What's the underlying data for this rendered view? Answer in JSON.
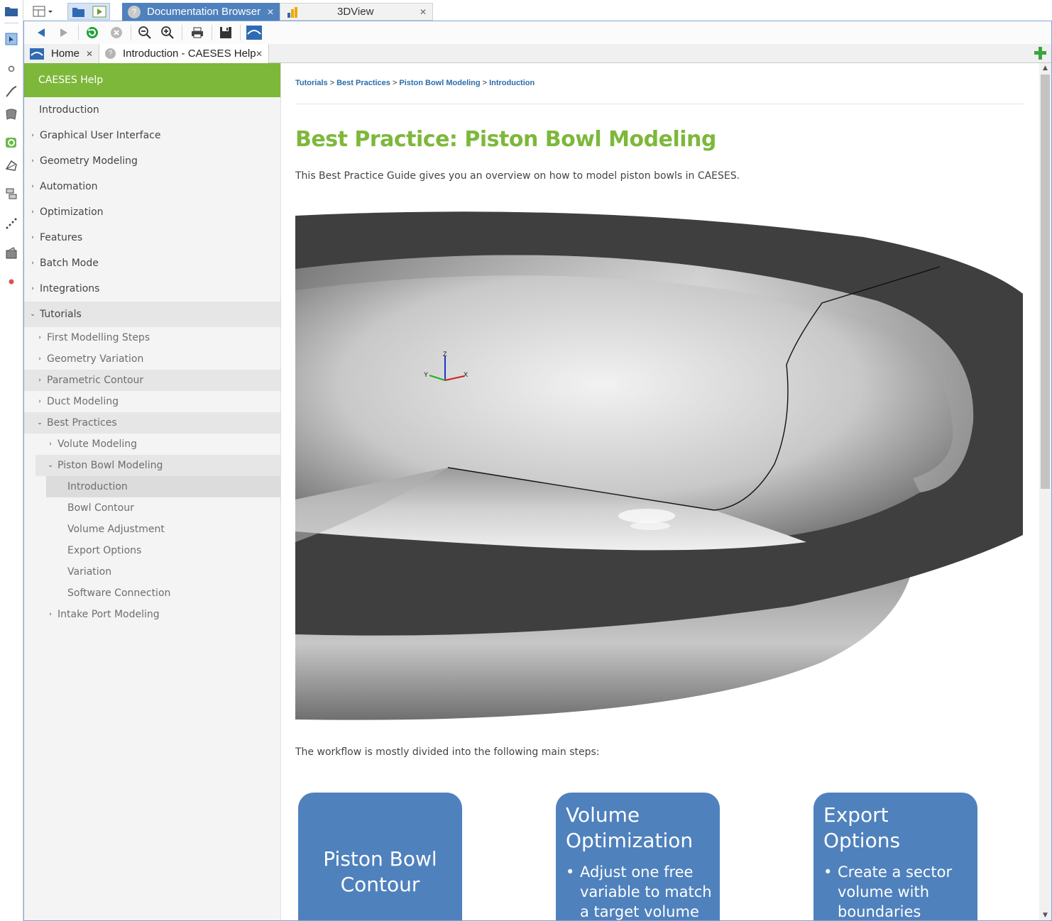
{
  "top_tabs": [
    {
      "label": "Documentation Browser",
      "icon": "help-icon",
      "active": true
    },
    {
      "label": "3DView",
      "icon": "chart-icon",
      "active": false
    }
  ],
  "doc_tabs": [
    {
      "label": "Home",
      "icon": "caeses-logo-icon"
    },
    {
      "label": "Introduction - CAESES Help",
      "icon": "help-icon"
    }
  ],
  "sidebar": {
    "header": "CAESES Help",
    "items": [
      {
        "label": "Introduction"
      },
      {
        "label": "Graphical User Interface"
      },
      {
        "label": "Geometry Modeling"
      },
      {
        "label": "Automation"
      },
      {
        "label": "Optimization"
      },
      {
        "label": "Features"
      },
      {
        "label": "Batch Mode"
      },
      {
        "label": "Integrations"
      },
      {
        "label": "Tutorials"
      },
      {
        "label": "First Modelling Steps"
      },
      {
        "label": "Geometry Variation"
      },
      {
        "label": "Parametric Contour"
      },
      {
        "label": "Duct Modeling"
      },
      {
        "label": "Best Practices"
      },
      {
        "label": "Volute Modeling"
      },
      {
        "label": "Piston Bowl Modeling"
      },
      {
        "label": "Introduction"
      },
      {
        "label": "Bowl Contour"
      },
      {
        "label": "Volume Adjustment"
      },
      {
        "label": "Export Options"
      },
      {
        "label": "Variation"
      },
      {
        "label": "Software Connection"
      },
      {
        "label": "Intake Port Modeling"
      }
    ]
  },
  "breadcrumb": [
    "Tutorials",
    "Best Practices",
    "Piston Bowl Modeling",
    "Introduction"
  ],
  "breadcrumb_sep": ">",
  "page": {
    "title": "Best Practice: Piston Bowl Modeling",
    "intro": "This Best Practice Guide gives you an overview on how to model piston bowls in CAESES.",
    "workflow_text": "The workflow is mostly divided into the following main steps:",
    "axis_labels": {
      "z": "Z",
      "y": "Y",
      "x": "X"
    }
  },
  "cards": [
    {
      "title_lines": [
        "Piston Bowl",
        "Contour"
      ],
      "bullets": []
    },
    {
      "title_lines": [
        "Volume",
        "Optimization"
      ],
      "bullets": [
        [
          "Adjust one free",
          "variable to match",
          "a target volume"
        ]
      ]
    },
    {
      "title_lines": [
        "Export",
        "Options"
      ],
      "bullets": [
        [
          "Create a sector",
          "volume with",
          "boundaries"
        ]
      ]
    }
  ],
  "colors": {
    "accent_green": "#7db83a",
    "link_blue": "#2a6dab",
    "card_blue": "#4f81bd",
    "frame_blue": "#7fa6d6"
  }
}
